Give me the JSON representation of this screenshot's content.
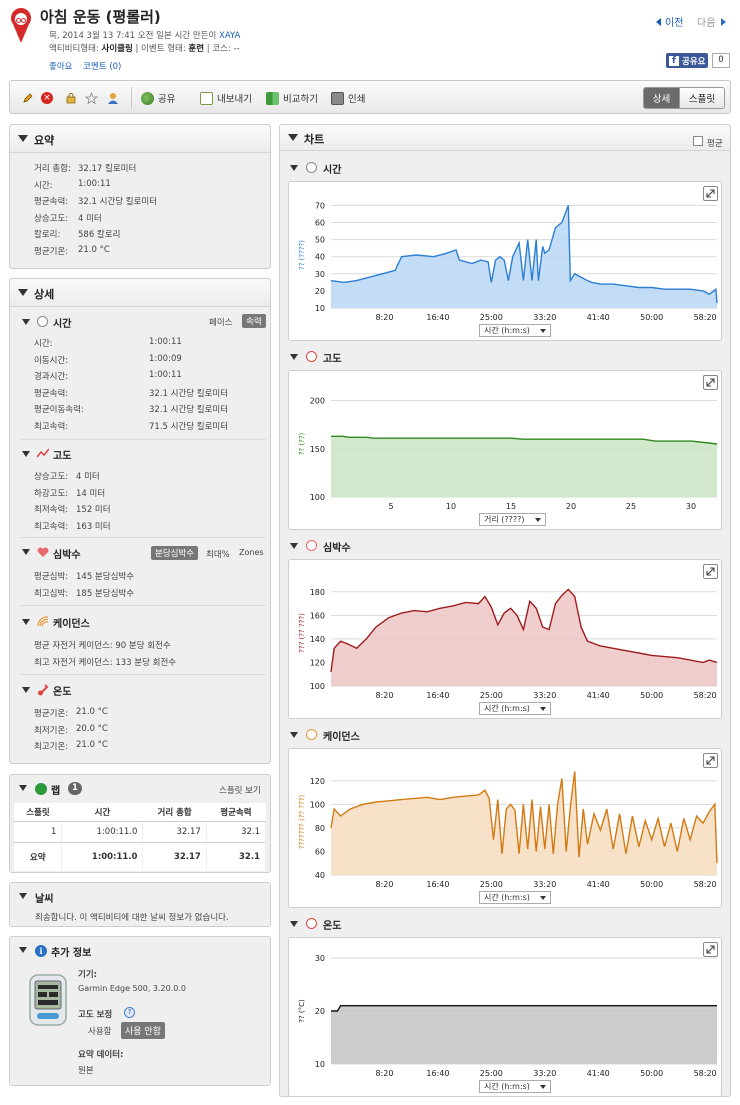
{
  "header": {
    "title": "아침 운동 (평롤러)",
    "date_line": "목, 2014 3월 13 7:41 오전 일본 시간 만든이",
    "creator": "XAYA",
    "activity_type_label": "액티비티형태:",
    "activity_type": "사이클링",
    "event_type_label": "| 이벤트 형태:",
    "event_type": "훈련",
    "course_label": "| 코스:",
    "course": "--",
    "like": "좋아요",
    "comments": "코멘트 (0)",
    "prev": "이전",
    "next": "다음",
    "fb_like": "공유요",
    "fb_count": "0"
  },
  "toolbar": {
    "share": "공유",
    "export": "내보내기",
    "compare": "비교하기",
    "print": "인쇄",
    "detail": "상세",
    "split": "스플릿"
  },
  "summary": {
    "title": "요약",
    "rows": [
      {
        "label": "거리 총합:",
        "value": "32.17 킬로미터"
      },
      {
        "label": "시간:",
        "value": "1:00:11"
      },
      {
        "label": "평균속력:",
        "value": "32.1 시간당 킬로미터"
      },
      {
        "label": "상승고도:",
        "value": "4 미터"
      },
      {
        "label": "칼로리:",
        "value": "586 칼로리"
      },
      {
        "label": "평균기온:",
        "value": "21.0 °C"
      }
    ]
  },
  "detail": {
    "title": "상세",
    "time": {
      "title": "시간",
      "pace": "페이스",
      "speed": "속력",
      "rows": [
        {
          "label": "시간:",
          "value": "1:00:11"
        },
        {
          "label": "이동시간:",
          "value": "1:00:09"
        },
        {
          "label": "경과시간:",
          "value": "1:00:11"
        },
        {
          "label": "평균속력:",
          "value": "32.1 시간당 킬로미터"
        },
        {
          "label": "평균이동속력:",
          "value": "32.1 시간당 킬로미터"
        },
        {
          "label": "최고속력:",
          "value": "71.5 시간당 킬로미터"
        }
      ]
    },
    "elevation": {
      "title": "고도",
      "rows": [
        {
          "label": "상승고도:",
          "value": "4 미터"
        },
        {
          "label": "하강고도:",
          "value": "14 미터"
        },
        {
          "label": "최저속력:",
          "value": "152 미터"
        },
        {
          "label": "최고속력:",
          "value": "163 미터"
        }
      ]
    },
    "heartrate": {
      "title": "심박수",
      "bpm": "분당심박수",
      "max": "최대%",
      "zones": "Zones",
      "rows": [
        {
          "label": "평균심박:",
          "value": "145 분당심박수"
        },
        {
          "label": "최고심박:",
          "value": "185 분당심박수"
        }
      ]
    },
    "cadence": {
      "title": "케이던스",
      "rows": [
        {
          "label": "평균 자전거 케이던스:",
          "value": "90 분당 회전수"
        },
        {
          "label": "최고 자전거 케이던스:",
          "value": "133 분당 회전수"
        }
      ]
    },
    "temperature": {
      "title": "온도",
      "rows": [
        {
          "label": "평균기온:",
          "value": "21.0 °C"
        },
        {
          "label": "최저기온:",
          "value": "20.0 °C"
        },
        {
          "label": "최고기온:",
          "value": "21.0 °C"
        }
      ]
    }
  },
  "laps": {
    "title": "랩",
    "count": "1",
    "split_view": "스플릿 보기",
    "columns": [
      "스플릿",
      "시간",
      "거리 총합",
      "평균속력"
    ],
    "rows": [
      [
        "1",
        "1:00:11.0",
        "32.17",
        "32.1"
      ]
    ],
    "summary_row": [
      "요약",
      "1:00:11.0",
      "32.17",
      "32.1"
    ]
  },
  "weather": {
    "title": "날씨",
    "message": "죄송합니다. 이 액티비티에 대한 날씨 정보가 없습니다."
  },
  "extra": {
    "title": "추가 정보",
    "device_label": "기기:",
    "device": "Garmin Edge 500, 3.20.0.0",
    "elev_corr_label": "고도 보정",
    "use": "사용함",
    "not_use": "사용 안함",
    "summary_data_label": "요약 데이터:",
    "summary_data": "원본"
  },
  "charts_panel": {
    "title": "차트",
    "avg_label": "평균"
  },
  "colors": {
    "speed": "#2b7fd4",
    "elevation": "#2e8a1e",
    "heartrate": "#a01c1c",
    "cadence": "#d27a12",
    "temperature": "#111111"
  },
  "chart_data": [
    {
      "type": "area",
      "title": "시간",
      "ylabel": "?? (????)",
      "xselect": "시간 (h:m:s)",
      "ylim": [
        10,
        72
      ],
      "yticks": [
        10,
        20,
        30,
        40,
        50,
        60,
        70
      ],
      "xlim": [
        0,
        3611
      ],
      "xticks": [
        500,
        1000,
        1500,
        2000,
        2500,
        3000,
        3500
      ],
      "xticklabels": [
        "8:20",
        "16:40",
        "25:00",
        "33:20",
        "41:40",
        "50:00",
        "58:20"
      ],
      "x": [
        0,
        120,
        240,
        360,
        480,
        600,
        660,
        800,
        960,
        1080,
        1170,
        1200,
        1320,
        1400,
        1470,
        1500,
        1540,
        1580,
        1620,
        1660,
        1700,
        1760,
        1800,
        1840,
        1880,
        1920,
        1940,
        1980,
        2000,
        2040,
        2100,
        2160,
        2220,
        2240,
        2280,
        2340,
        2370,
        2400,
        2440,
        2520,
        2640,
        2760,
        2880,
        3000,
        3120,
        3240,
        3360,
        3480,
        3540,
        3600,
        3611
      ],
      "values": [
        26,
        25,
        26,
        28,
        30,
        32,
        40,
        41,
        40,
        42,
        44,
        38,
        36,
        38,
        37,
        25,
        38,
        40,
        38,
        26,
        40,
        48,
        26,
        50,
        26,
        50,
        26,
        46,
        42,
        44,
        57,
        60,
        70,
        26,
        30,
        28,
        27,
        26,
        25,
        24,
        24,
        23,
        22,
        22,
        21,
        21,
        21,
        20,
        18,
        21,
        13
      ],
      "series": [
        {
          "name": "",
          "color": "#2b7fd4"
        }
      ]
    },
    {
      "type": "area",
      "title": "고도",
      "ylabel": "?? (??)",
      "xselect": "거리 (????)",
      "ylim": [
        100,
        210
      ],
      "yticks": [
        100,
        150,
        200
      ],
      "xlim": [
        0,
        32.17
      ],
      "xticks": [
        5,
        10,
        15,
        20,
        25,
        30
      ],
      "xticklabels": [
        "5",
        "10",
        "15",
        "20",
        "25",
        "30"
      ],
      "x": [
        0,
        1,
        1.5,
        3,
        3.5,
        15,
        16,
        26,
        27,
        30,
        31.5,
        32.17
      ],
      "values": [
        163,
        163,
        162,
        162,
        161,
        161,
        160,
        160,
        158,
        158,
        156,
        155
      ],
      "series": [
        {
          "name": "",
          "color": "#2e8a1e"
        }
      ]
    },
    {
      "type": "area",
      "title": "심박수",
      "ylabel": "??? (?? ???)",
      "xselect": "시간 (h:m:s)",
      "ylim": [
        100,
        190
      ],
      "yticks": [
        100,
        120,
        140,
        160,
        180
      ],
      "xlim": [
        0,
        3611
      ],
      "xticks": [
        500,
        1000,
        1500,
        2000,
        2500,
        3000,
        3500
      ],
      "xticklabels": [
        "8:20",
        "16:40",
        "25:00",
        "33:20",
        "41:40",
        "50:00",
        "58:20"
      ],
      "x": [
        0,
        30,
        90,
        150,
        240,
        330,
        420,
        540,
        660,
        780,
        900,
        1020,
        1140,
        1260,
        1380,
        1440,
        1500,
        1560,
        1620,
        1680,
        1740,
        1800,
        1860,
        1920,
        1980,
        2040,
        2100,
        2160,
        2220,
        2280,
        2340,
        2400,
        2520,
        2640,
        2760,
        2880,
        3000,
        3120,
        3240,
        3360,
        3480,
        3540,
        3611
      ],
      "values": [
        112,
        132,
        138,
        136,
        132,
        140,
        150,
        158,
        162,
        164,
        163,
        166,
        168,
        171,
        170,
        176,
        167,
        152,
        162,
        166,
        160,
        148,
        172,
        166,
        150,
        148,
        170,
        177,
        182,
        176,
        150,
        138,
        134,
        132,
        130,
        128,
        126,
        125,
        124,
        122,
        120,
        122,
        120
      ],
      "series": [
        {
          "name": "",
          "color": "#a01c1c"
        }
      ]
    },
    {
      "type": "area",
      "title": "케이던스",
      "ylabel": "??????? (?? ???)",
      "xselect": "시간 (h:m:s)",
      "ylim": [
        40,
        130
      ],
      "yticks": [
        40,
        60,
        80,
        100,
        120
      ],
      "xlim": [
        0,
        3611
      ],
      "xticks": [
        500,
        1000,
        1500,
        2000,
        2500,
        3000,
        3500
      ],
      "xticklabels": [
        "8:20",
        "16:40",
        "25:00",
        "33:20",
        "41:40",
        "50:00",
        "58:20"
      ],
      "x": [
        0,
        30,
        90,
        180,
        300,
        420,
        540,
        660,
        780,
        900,
        1020,
        1140,
        1260,
        1380,
        1440,
        1480,
        1520,
        1560,
        1600,
        1640,
        1680,
        1720,
        1760,
        1800,
        1840,
        1880,
        1920,
        1960,
        2000,
        2040,
        2080,
        2120,
        2160,
        2200,
        2240,
        2280,
        2320,
        2360,
        2400,
        2460,
        2520,
        2580,
        2640,
        2700,
        2760,
        2820,
        2880,
        2940,
        3000,
        3060,
        3120,
        3180,
        3240,
        3300,
        3360,
        3420,
        3480,
        3540,
        3590,
        3611
      ],
      "values": [
        80,
        96,
        90,
        96,
        100,
        102,
        103,
        104,
        105,
        106,
        104,
        106,
        107,
        108,
        112,
        105,
        70,
        104,
        58,
        96,
        100,
        95,
        58,
        100,
        62,
        104,
        60,
        98,
        62,
        100,
        58,
        100,
        122,
        60,
        98,
        128,
        55,
        96,
        66,
        92,
        78,
        96,
        62,
        92,
        58,
        90,
        64,
        86,
        70,
        88,
        64,
        84,
        60,
        88,
        70,
        90,
        84,
        94,
        100,
        50
      ],
      "series": [
        {
          "name": "",
          "color": "#d27a12"
        }
      ]
    },
    {
      "type": "area",
      "title": "온도",
      "ylabel": "?? (°C)",
      "xselect": "시간 (h:m:s)",
      "ylim": [
        10,
        30
      ],
      "yticks": [
        10,
        20,
        30
      ],
      "xlim": [
        0,
        3611
      ],
      "xticks": [
        500,
        1000,
        1500,
        2000,
        2500,
        3000,
        3500
      ],
      "xticklabels": [
        "8:20",
        "16:40",
        "25:00",
        "33:20",
        "41:40",
        "50:00",
        "58:20"
      ],
      "x": [
        0,
        60,
        90,
        120,
        3611
      ],
      "values": [
        20,
        20,
        21,
        21,
        21
      ],
      "series": [
        {
          "name": "",
          "color": "#111111"
        }
      ]
    }
  ]
}
